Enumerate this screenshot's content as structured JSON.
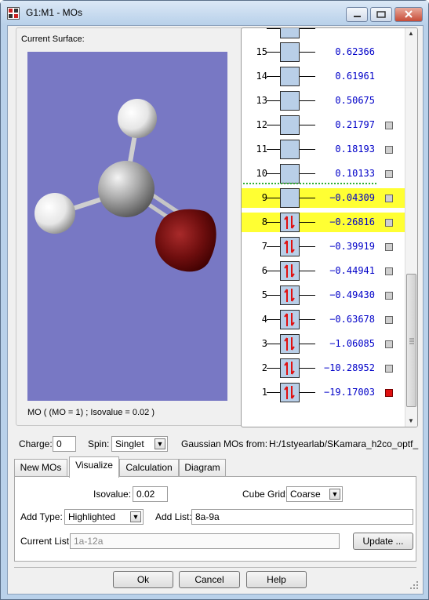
{
  "window": {
    "title": "G1:M1 - MOs"
  },
  "surface": {
    "label": "Current Surface:",
    "caption": "MO ( (MO = 1) ; Isovalue = 0.02 )"
  },
  "mo_list": [
    {
      "n": "15",
      "energy": "0.62366",
      "occupied": false,
      "highlighted": false,
      "checkbox": false,
      "selected": false
    },
    {
      "n": "14",
      "energy": "0.61961",
      "occupied": false,
      "highlighted": false,
      "checkbox": false,
      "selected": false
    },
    {
      "n": "13",
      "energy": "0.50675",
      "occupied": false,
      "highlighted": false,
      "checkbox": false,
      "selected": false
    },
    {
      "n": "12",
      "energy": "0.21797",
      "occupied": false,
      "highlighted": false,
      "checkbox": true,
      "selected": false
    },
    {
      "n": "11",
      "energy": "0.18193",
      "occupied": false,
      "highlighted": false,
      "checkbox": true,
      "selected": false
    },
    {
      "n": "10",
      "energy": "0.10133",
      "occupied": false,
      "highlighted": false,
      "checkbox": true,
      "selected": false
    },
    {
      "n": "9",
      "energy": "−0.04309",
      "occupied": false,
      "highlighted": true,
      "checkbox": true,
      "selected": false
    },
    {
      "n": "8",
      "energy": "−0.26816",
      "occupied": true,
      "highlighted": true,
      "checkbox": true,
      "selected": false
    },
    {
      "n": "7",
      "energy": "−0.39919",
      "occupied": true,
      "highlighted": false,
      "checkbox": true,
      "selected": false
    },
    {
      "n": "6",
      "energy": "−0.44941",
      "occupied": true,
      "highlighted": false,
      "checkbox": true,
      "selected": false
    },
    {
      "n": "5",
      "energy": "−0.49430",
      "occupied": true,
      "highlighted": false,
      "checkbox": true,
      "selected": false
    },
    {
      "n": "4",
      "energy": "−0.63678",
      "occupied": true,
      "highlighted": false,
      "checkbox": true,
      "selected": false
    },
    {
      "n": "3",
      "energy": "−1.06085",
      "occupied": true,
      "highlighted": false,
      "checkbox": true,
      "selected": false
    },
    {
      "n": "2",
      "energy": "−10.28952",
      "occupied": true,
      "highlighted": false,
      "checkbox": true,
      "selected": false
    },
    {
      "n": "1",
      "energy": "−19.17003",
      "occupied": true,
      "highlighted": false,
      "checkbox": true,
      "selected": true
    }
  ],
  "charge": {
    "label": "Charge:",
    "value": "0"
  },
  "spin": {
    "label": "Spin:",
    "value": "Singlet"
  },
  "source": {
    "label": "Gaussian MOs from:",
    "path": "H:/1styearlab/SKamara_h2co_optf_"
  },
  "tabs": [
    "New MOs",
    "Visualize",
    "Calculation",
    "Diagram"
  ],
  "active_tab": "Visualize",
  "visualize": {
    "isovalue_label": "Isovalue:",
    "isovalue": "0.02",
    "cube_grid_label": "Cube Grid:",
    "cube_grid": "Coarse",
    "add_type_label": "Add Type:",
    "add_type": "Highlighted",
    "add_list_label": "Add List:",
    "add_list": "8a-9a",
    "current_list_label": "Current List:",
    "current_list": "1a-12a",
    "update_button": "Update ..."
  },
  "buttons": {
    "ok": "Ok",
    "cancel": "Cancel",
    "help": "Help"
  },
  "colors": {
    "viewer_bg": "#7878c4",
    "highlight": "#ffff33",
    "energy_text": "#0000c8",
    "electron_arrow": "#e01010",
    "selected_check": "#e01010"
  }
}
